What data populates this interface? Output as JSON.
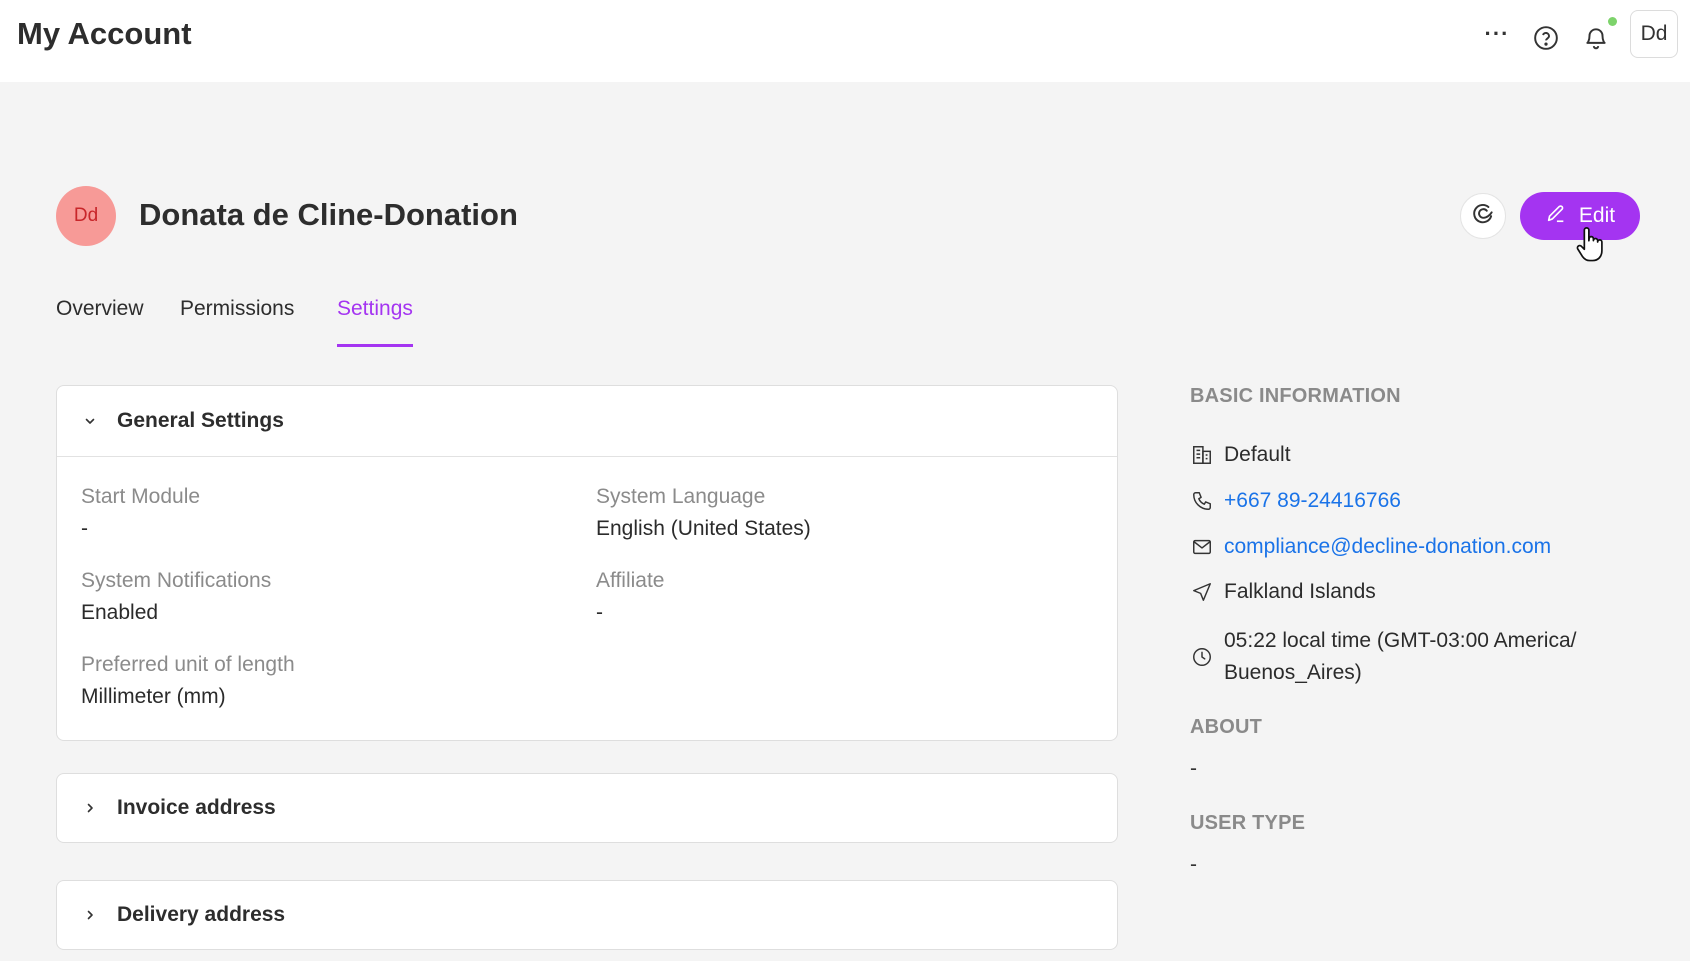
{
  "header": {
    "title": "My Account",
    "more_label": "···",
    "user_initials": "Dd"
  },
  "profile": {
    "initials": "Dd",
    "name": "Donata de Cline-Donation",
    "edit_label": "Edit"
  },
  "tabs": [
    {
      "label": "Overview",
      "active": false
    },
    {
      "label": "Permissions",
      "active": false
    },
    {
      "label": "Settings",
      "active": true
    }
  ],
  "general_settings": {
    "title": "General Settings",
    "fields": {
      "start_module": {
        "label": "Start Module",
        "value": "-"
      },
      "system_language": {
        "label": "System Language",
        "value": "English (United States)"
      },
      "system_notifications": {
        "label": "System Notifications",
        "value": "Enabled"
      },
      "affiliate": {
        "label": "Affiliate",
        "value": "-"
      },
      "unit_of_length": {
        "label": "Preferred unit of length",
        "value": "Millimeter (mm)"
      }
    }
  },
  "invoice_address": {
    "title": "Invoice address"
  },
  "delivery_address": {
    "title": "Delivery address"
  },
  "basic_info": {
    "heading": "BASIC INFORMATION",
    "workspace": "Default",
    "phone": "+667 89-24416766",
    "email": "compliance@decline-donation.com",
    "location": "Falkland Islands",
    "local_time_line1": "05:22 local time (GMT-03:00 America/",
    "local_time_line2": "Buenos_Aires)"
  },
  "about": {
    "heading": "ABOUT",
    "value": "-"
  },
  "user_type": {
    "heading": "USER TYPE",
    "value": "-"
  },
  "colors": {
    "accent": "#a434f1",
    "link": "#1a73e8",
    "avatar_bg": "#f79a97"
  }
}
